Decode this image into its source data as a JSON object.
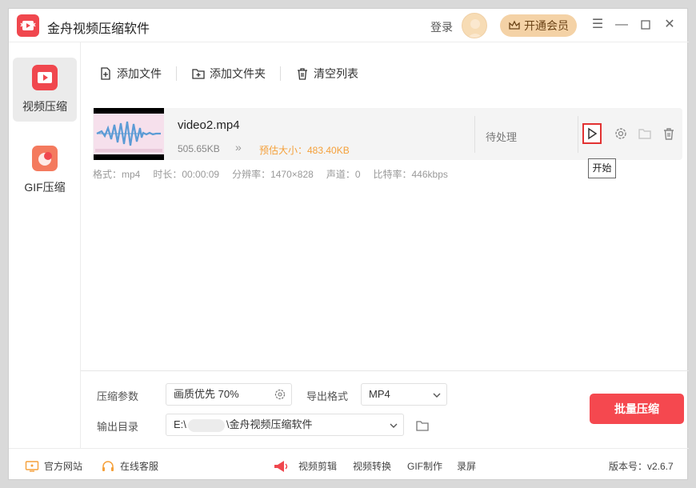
{
  "app": {
    "title": "金舟视频压缩软件"
  },
  "header": {
    "login_label": "登录",
    "vip_label": "开通会员"
  },
  "sidebar": {
    "items": [
      {
        "label": "视频压缩"
      },
      {
        "label": "GIF压缩"
      }
    ]
  },
  "toolbar": {
    "add_file": "添加文件",
    "add_folder": "添加文件夹",
    "clear_list": "清空列表"
  },
  "file": {
    "name": "video2.mp4",
    "size": "505.65KB",
    "estimate": "预估大小：483.40KB",
    "status": "待处理",
    "tooltip": "开始",
    "meta": {
      "format": "格式：mp4",
      "duration": "时长：00:00:09",
      "resolution": "分辨率：1470×828",
      "channel": "声道：0",
      "bitrate": "比特率：446kbps"
    }
  },
  "settings": {
    "params_label": "压缩参数",
    "params_value": "画质优先 70%",
    "format_label": "导出格式",
    "format_value": "MP4",
    "outdir_label": "输出目录",
    "outdir_value_start": "E:\\",
    "outdir_value_end": "\\金舟视频压缩软件",
    "batch_label": "批量压缩"
  },
  "footer": {
    "website": "官方网站",
    "support": "在线客服",
    "links": [
      "视频剪辑",
      "视频转换",
      "GIF制作",
      "录屏"
    ],
    "version": "版本号：v2.6.7"
  },
  "colors": {
    "accent": "#f5484f",
    "warning": "#f5a03a",
    "vip": "#f4d2a6"
  }
}
